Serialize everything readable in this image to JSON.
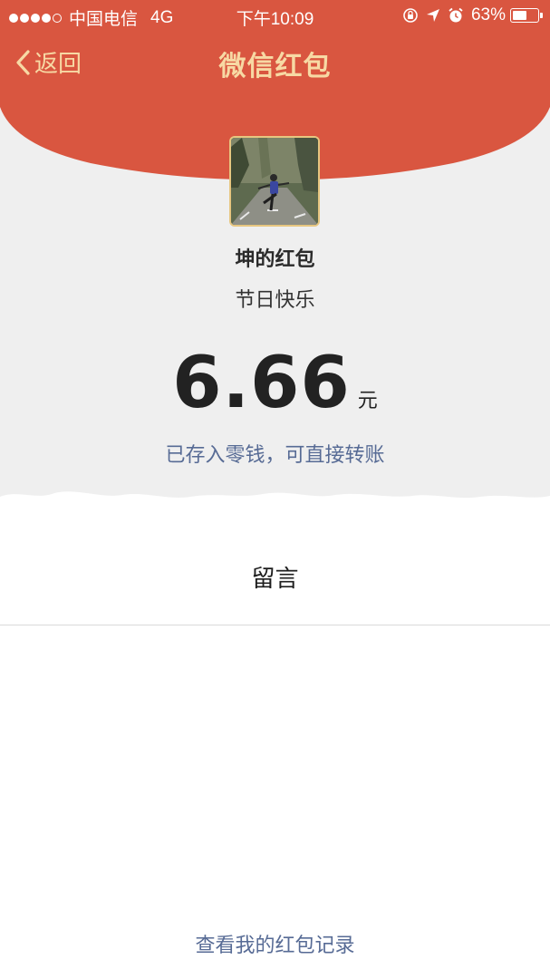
{
  "status_bar": {
    "carrier": "中国电信",
    "network": "4G",
    "time": "下午10:09",
    "battery_percent": "63%",
    "battery_level": 0.63,
    "signal_bars_filled": 4,
    "signal_bars_total": 5
  },
  "nav": {
    "back_label": "返回",
    "title": "微信红包"
  },
  "envelope": {
    "sender_name": "坤的红包",
    "greeting": "节日快乐",
    "amount": "6.66",
    "currency_unit": "元",
    "balance_note": "已存入零钱，可直接转账"
  },
  "message": {
    "label": "留言"
  },
  "footer": {
    "records_link": "查看我的红包记录"
  },
  "colors": {
    "header_red": "#d95640",
    "title_gold": "#f7d9a4",
    "link_blue": "#576b95",
    "card_grey": "#efefef"
  }
}
